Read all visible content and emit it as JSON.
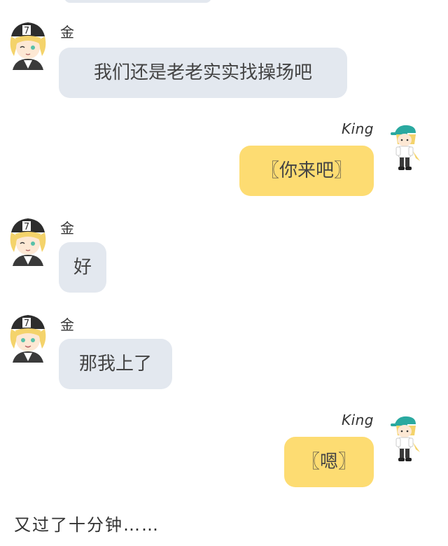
{
  "messages": [
    {
      "side": "left",
      "sender": "金",
      "text": "我们还是老老实实找操场吧"
    },
    {
      "side": "right",
      "sender": "King",
      "text": "〖你来吧〗"
    },
    {
      "side": "left",
      "sender": "金",
      "text": "好"
    },
    {
      "side": "left",
      "sender": "金",
      "text": "那我上了"
    },
    {
      "side": "right",
      "sender": "King",
      "text": "〖嗯〗"
    }
  ],
  "narration": "又过了十分钟……",
  "colors": {
    "left_bubble": "#e3e8ef",
    "right_bubble": "#fddc72"
  },
  "icons": {
    "left_avatar": "anime-boy-cap-avatar",
    "right_avatar": "chibi-character-avatar"
  }
}
